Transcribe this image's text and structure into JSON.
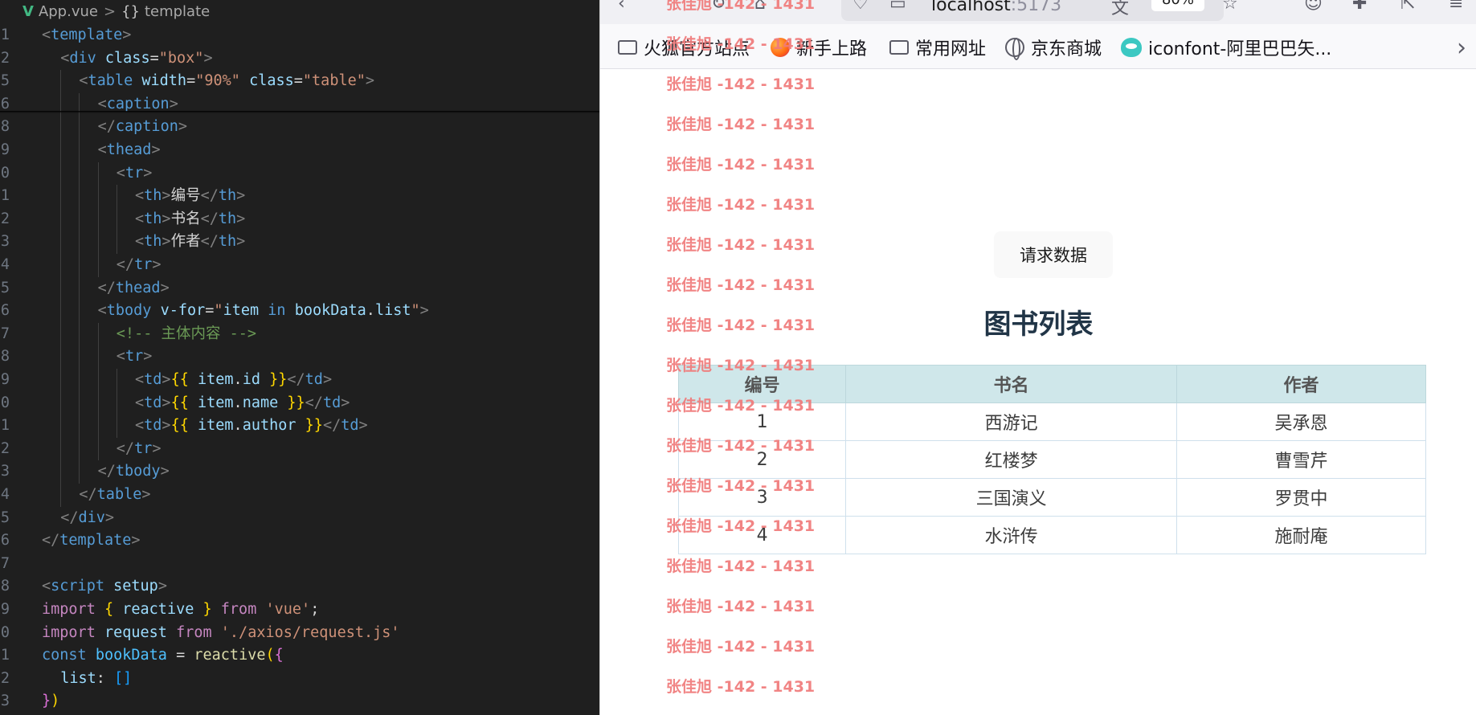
{
  "editor": {
    "breadcrumb": {
      "file": "App.vue",
      "separator": ">",
      "braces": "{}",
      "symbol": "template"
    },
    "line_numbers": [
      "1",
      "2",
      "5",
      "6",
      "8",
      "9",
      "0",
      "1",
      "2",
      "3",
      "4",
      "5",
      "6",
      "7",
      "8",
      "9",
      "0",
      "1",
      "2",
      "3",
      "4",
      "5",
      "6",
      "7",
      "8",
      "9",
      "0",
      "1",
      "2",
      "3"
    ]
  },
  "browser": {
    "url": {
      "host": "localhost",
      "port": ":5173",
      "zoom": "80%"
    },
    "bookmarks": [
      {
        "label": "火狐官方站点",
        "icon": "folder-icon"
      },
      {
        "label": "新手上路",
        "icon": "firefox-icon"
      },
      {
        "label": "常用网址",
        "icon": "folder-icon"
      },
      {
        "label": "京东商城",
        "icon": "globe-icon"
      },
      {
        "label": "iconfont-阿里巴巴矢...",
        "icon": "iconfont-icon"
      }
    ],
    "overflow_label": "›"
  },
  "page": {
    "request_button": "请求数据",
    "table": {
      "caption": "图书列表",
      "headers": [
        "编号",
        "书名",
        "作者"
      ],
      "rows": [
        [
          "1",
          "西游记",
          "吴承恩"
        ],
        [
          "2",
          "红楼梦",
          "曹雪芹"
        ],
        [
          "3",
          "三国演义",
          "罗贯中"
        ],
        [
          "4",
          "水浒传",
          "施耐庵"
        ]
      ]
    }
  },
  "watermark": {
    "text": "张佳旭 -142 - 1431"
  },
  "colors": {
    "editor_bg": "#1f1f1f",
    "table_header_bg": "#cfe7ea",
    "watermark": "#f07a7a",
    "caption": "#213547"
  }
}
